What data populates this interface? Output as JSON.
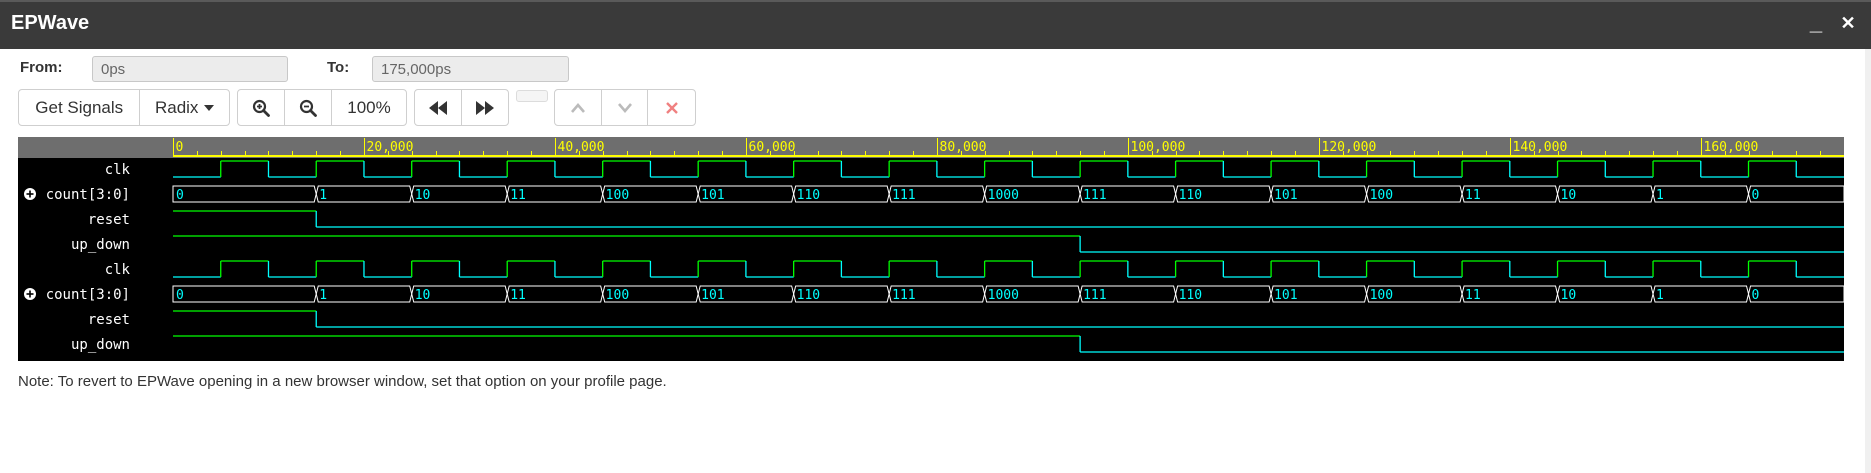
{
  "window": {
    "title": "EPWave",
    "minimize_glyph": "_",
    "close_glyph": "✕"
  },
  "range": {
    "from_label": "From:",
    "from_value": "0ps",
    "to_label": "To:",
    "to_value": "175,000ps"
  },
  "toolbar": {
    "get_signals": "Get Signals",
    "radix": "Radix",
    "zoom_in_icon": "zoom-in-icon",
    "zoom_out_icon": "zoom-out-icon",
    "zoom_level": "100%",
    "rewind_icon": "rewind-icon",
    "fast_forward_icon": "fast-forward-icon",
    "up_icon": "chevron-up-icon",
    "down_icon": "chevron-down-icon",
    "remove_icon": "close-icon"
  },
  "colors": {
    "waveform_bg": "#000000",
    "ruler_bg": "#6e6e6e",
    "ruler_text": "#ffff00",
    "clock_high": "#00ff00",
    "clock_low": "#00ffff",
    "bus_text": "#00ffff",
    "bus_outline": "#ffffff",
    "signal_name": "#ffffff",
    "reset_high": "#00ff00",
    "reset_low": "#00ffff"
  },
  "waveform": {
    "time_start": 0,
    "time_end": 175000,
    "ruler_labels": [
      "0",
      "20,000",
      "40,000",
      "60,000",
      "80,000",
      "100,000",
      "120,000",
      "140,000",
      "160,000"
    ],
    "ruler_values": [
      0,
      20000,
      40000,
      60000,
      80000,
      100000,
      120000,
      140000,
      160000
    ],
    "minor_tick_step": 2500,
    "clock_period": 10000,
    "clock_first_rise": 5000,
    "signals": [
      {
        "name": "clk",
        "type": "clock",
        "expandable": false
      },
      {
        "name": "count[3:0]",
        "type": "bus",
        "expandable": true,
        "transitions": [
          0,
          15000,
          25000,
          35000,
          45000,
          55000,
          65000,
          75000,
          85000,
          95000,
          105000,
          115000,
          125000,
          135000,
          145000,
          155000,
          165000
        ],
        "values": [
          "0",
          "1",
          "10",
          "11",
          "100",
          "101",
          "110",
          "111",
          "1000",
          "111",
          "110",
          "101",
          "100",
          "11",
          "10",
          "1",
          "0"
        ]
      },
      {
        "name": "reset",
        "type": "bit",
        "expandable": false,
        "initial": 1,
        "transitions": [
          15000
        ]
      },
      {
        "name": "up_down",
        "type": "bit",
        "expandable": false,
        "initial": 1,
        "transitions": [
          95000
        ]
      },
      {
        "name": "clk",
        "type": "clock",
        "expandable": false
      },
      {
        "name": "count[3:0]",
        "type": "bus",
        "expandable": true,
        "transitions": [
          0,
          15000,
          25000,
          35000,
          45000,
          55000,
          65000,
          75000,
          85000,
          95000,
          105000,
          115000,
          125000,
          135000,
          145000,
          155000,
          165000
        ],
        "values": [
          "0",
          "1",
          "10",
          "11",
          "100",
          "101",
          "110",
          "111",
          "1000",
          "111",
          "110",
          "101",
          "100",
          "11",
          "10",
          "1",
          "0"
        ]
      },
      {
        "name": "reset",
        "type": "bit",
        "expandable": false,
        "initial": 1,
        "transitions": [
          15000
        ]
      },
      {
        "name": "up_down",
        "type": "bit",
        "expandable": false,
        "initial": 1,
        "transitions": [
          95000
        ]
      }
    ]
  },
  "note": "Note: To revert to EPWave opening in a new browser window, set that option on your profile page."
}
